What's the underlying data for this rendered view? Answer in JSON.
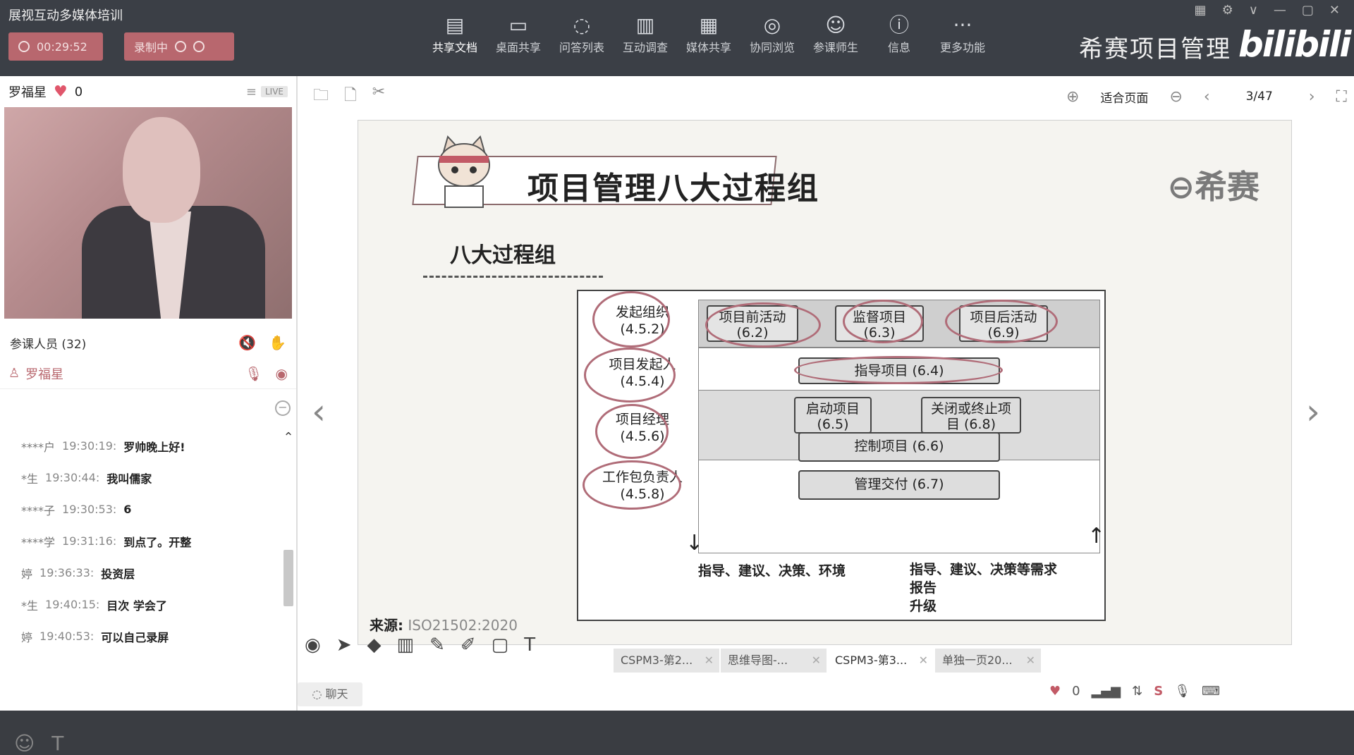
{
  "app": {
    "title": "展视互动多媒体培训",
    "timer": "00:29:52",
    "record_label": "录制中"
  },
  "toolbar": {
    "items": [
      {
        "label": "共享文档",
        "icon": "document-icon"
      },
      {
        "label": "桌面共享",
        "icon": "desktop-share-icon"
      },
      {
        "label": "问答列表",
        "icon": "qa-icon"
      },
      {
        "label": "互动调查",
        "icon": "poll-icon"
      },
      {
        "label": "媒体共享",
        "icon": "media-icon"
      },
      {
        "label": "协同浏览",
        "icon": "browse-icon"
      },
      {
        "label": "参课师生",
        "icon": "attendees-icon"
      },
      {
        "label": "信息",
        "icon": "info-icon"
      },
      {
        "label": "更多功能",
        "icon": "more-icon"
      }
    ]
  },
  "brand": {
    "name": "希赛项目管理",
    "logo_text": "bilibili"
  },
  "presenter": {
    "name": "罗福星",
    "likes": "0",
    "live_badge": "LIVE"
  },
  "participants": {
    "label": "参课人员 (32)",
    "me": "罗福星"
  },
  "chat": {
    "messages": [
      {
        "who": "****户",
        "time": "19:30:19:",
        "text": "罗帅晚上好!"
      },
      {
        "who": "*生",
        "time": "19:30:44:",
        "text": "我叫儒家"
      },
      {
        "who": "****子",
        "time": "19:30:53:",
        "text": "6"
      },
      {
        "who": "****学",
        "time": "19:31:16:",
        "text": "到点了。开整"
      },
      {
        "who": "婷",
        "time": "19:36:33:",
        "text": "投资层"
      },
      {
        "who": "*生",
        "time": "19:40:15:",
        "text": "目次 学会了"
      },
      {
        "who": "婷",
        "time": "19:40:53:",
        "text": "可以自己录屏"
      }
    ],
    "button": "聊天"
  },
  "viewer": {
    "fit_label": "适合页面",
    "page": "3/47"
  },
  "slide": {
    "title": "项目管理八大过程组",
    "subtitle": "八大过程组",
    "logo": "⊖希赛",
    "source_label": "来源:",
    "source_value": "ISO21502:2020",
    "stakeholders": [
      {
        "name": "发起组织",
        "code": "(4.5.2)"
      },
      {
        "name": "项目发起人",
        "code": "(4.5.4)"
      },
      {
        "name": "项目经理",
        "code": "(4.5.6)"
      },
      {
        "name": "工作包负责人",
        "code": "(4.5.8)"
      }
    ],
    "processes": {
      "pre": {
        "name": "项目前活动",
        "code": "(6.2)"
      },
      "supervise": {
        "name": "监督项目",
        "code": "(6.3)"
      },
      "post": {
        "name": "项目后活动",
        "code": "(6.9)"
      },
      "direct": "指导项目 (6.4)",
      "start": {
        "name": "启动项目",
        "code": "(6.5)"
      },
      "close": {
        "name": "关闭或终止项",
        "code": "目 (6.8)"
      },
      "control": "控制项目 (6.6)",
      "deliver": "管理交付 (6.7)"
    },
    "bottom_left": "指导、建议、决策、环境",
    "bottom_right": [
      "指导、建议、决策等需求",
      "报告",
      "升级"
    ]
  },
  "tabs": [
    "CSPM3-第2...",
    "思维导图-...",
    "CSPM3-第3...",
    "单独一页20..."
  ],
  "status": {
    "likes": "0"
  },
  "colors": {
    "accent": "#b8676e",
    "topbar": "#3b3f46",
    "annotation": "#b06c78"
  }
}
